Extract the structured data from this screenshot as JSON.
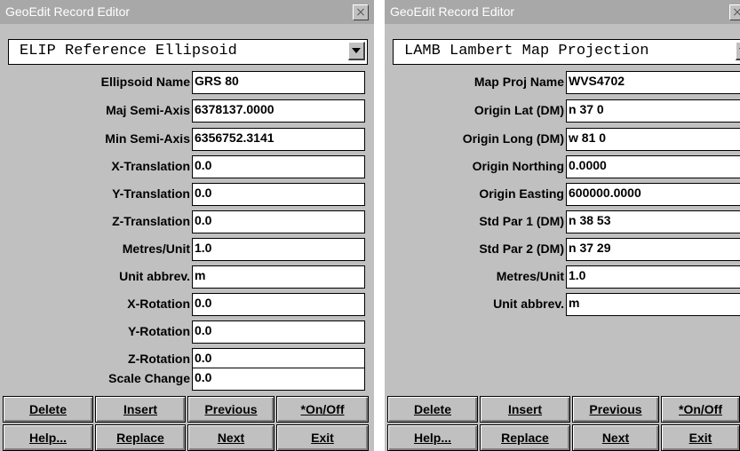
{
  "left": {
    "title": "GeoEdit Record Editor",
    "close_glyph": "×",
    "combo_value": "ELIP Reference Ellipsoid",
    "fields": [
      {
        "label": "Ellipsoid Name",
        "value": "GRS 80"
      },
      {
        "label": "Maj Semi-Axis",
        "value": "6378137.0000"
      },
      {
        "label": "Min Semi-Axis",
        "value": "6356752.3141"
      },
      {
        "label": "X-Translation",
        "value": "0.0"
      },
      {
        "label": "Y-Translation",
        "value": "0.0"
      },
      {
        "label": "Z-Translation",
        "value": "0.0"
      },
      {
        "label": "Metres/Unit",
        "value": "1.0"
      },
      {
        "label": "Unit abbrev.",
        "value": "m"
      },
      {
        "label": "X-Rotation",
        "value": "0.0"
      },
      {
        "label": "Y-Rotation",
        "value": "0.0"
      },
      {
        "label": "Z-Rotation",
        "value": "0.0"
      },
      {
        "label": "Scale Change",
        "value": "0.0"
      }
    ],
    "buttons": {
      "delete": "Delete",
      "insert": "Insert",
      "previous": "Previous",
      "onoff": "*On/Off",
      "help": "Help...",
      "replace": "Replace",
      "next": "Next",
      "exit": "Exit"
    }
  },
  "right": {
    "title": "GeoEdit Record Editor",
    "close_glyph": "×",
    "combo_value": "LAMB Lambert Map Projection",
    "fields": [
      {
        "label": "Map Proj Name",
        "value": "WVS4702"
      },
      {
        "label": "Origin Lat (DM)",
        "value": "n 37  0"
      },
      {
        "label": "Origin Long (DM)",
        "value": "w 81  0"
      },
      {
        "label": "Origin Northing",
        "value": "0.0000"
      },
      {
        "label": "Origin Easting",
        "value": "600000.0000"
      },
      {
        "label": "Std Par 1 (DM)",
        "value": "n 38 53"
      },
      {
        "label": "Std Par 2 (DM)",
        "value": "n 37 29"
      },
      {
        "label": "Metres/Unit",
        "value": "1.0"
      },
      {
        "label": "Unit abbrev.",
        "value": "m"
      }
    ],
    "buttons": {
      "delete": "Delete",
      "insert": "Insert",
      "previous": "Previous",
      "onoff": "*On/Off",
      "help": "Help...",
      "replace": "Replace",
      "next": "Next",
      "exit": "Exit"
    }
  }
}
